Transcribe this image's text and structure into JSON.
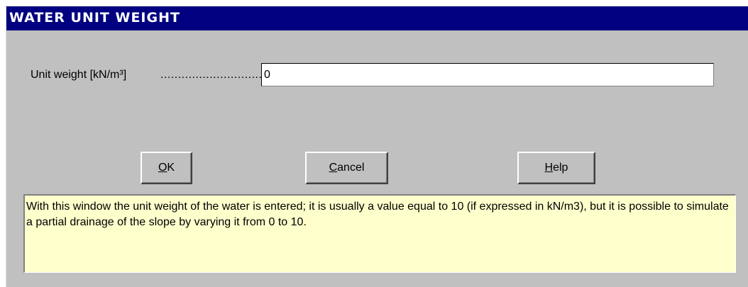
{
  "window": {
    "title": "WATER UNIT WEIGHT",
    "colors": {
      "titlebar": "#000080",
      "face": "#c0c0c0",
      "help_bg": "#ffffcc"
    }
  },
  "form": {
    "label": "Unit weight [kN/m³]",
    "leader": "...........................................",
    "value": "0"
  },
  "buttons": {
    "ok": {
      "mnemonic": "O",
      "rest": "K"
    },
    "cancel": {
      "mnemonic": "C",
      "rest": "ancel"
    },
    "help": {
      "mnemonic": "H",
      "rest": "elp"
    }
  },
  "help_text": "With this window the unit weight of the water is entered; it is usually a value equal to 10 (if expressed in kN/m3), but it is possible to simulate a partial drainage of the slope by varying it from 0 to 10."
}
